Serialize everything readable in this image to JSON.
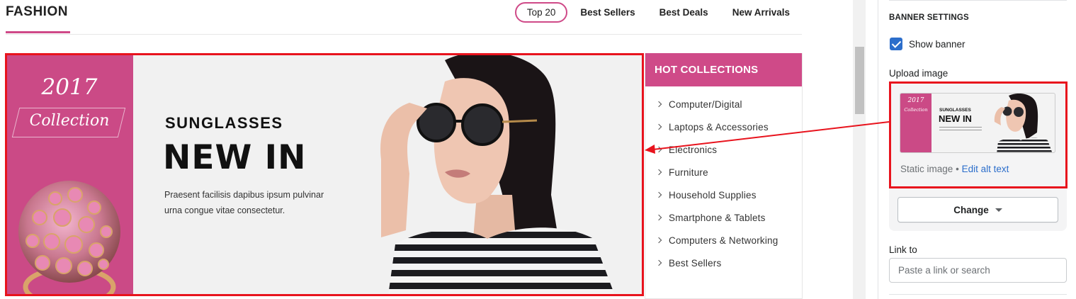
{
  "storefront": {
    "section_title": "FASHION",
    "tabs": [
      {
        "label": "Top 20",
        "active": true
      },
      {
        "label": "Best Sellers",
        "active": false
      },
      {
        "label": "Best Deals",
        "active": false
      },
      {
        "label": "New Arrivals",
        "active": false
      }
    ],
    "banner": {
      "year": "2017",
      "collection": "Collection",
      "subheading": "SUNGLASSES",
      "heading": "NEW IN",
      "body": "Praesent facilisis dapibus ipsum pulvinar urna congue vitae consectetur."
    },
    "hot_collections": {
      "title": "HOT COLLECTIONS",
      "items": [
        "Computer/Digital",
        "Laptops & Accessories",
        "Electronics",
        "Furniture",
        "Household Supplies",
        "Smartphone & Tablets",
        "Computers & Networking",
        "Best Sellers"
      ]
    }
  },
  "settings": {
    "heading": "BANNER SETTINGS",
    "show_banner_label": "Show banner",
    "show_banner_checked": true,
    "upload_label": "Upload image",
    "image_status": "Static image",
    "separator": "•",
    "edit_alt_text": "Edit alt text",
    "change_button": "Change",
    "link_label": "Link to",
    "link_placeholder": "Paste a link or search",
    "link_value": ""
  },
  "colors": {
    "brand_pink": "#cf4a88",
    "annotation_red": "#e8131d",
    "checkbox_blue": "#2c6ecb"
  },
  "icons": [
    "chevron-right-icon",
    "checkmark-icon",
    "caret-down-icon"
  ]
}
